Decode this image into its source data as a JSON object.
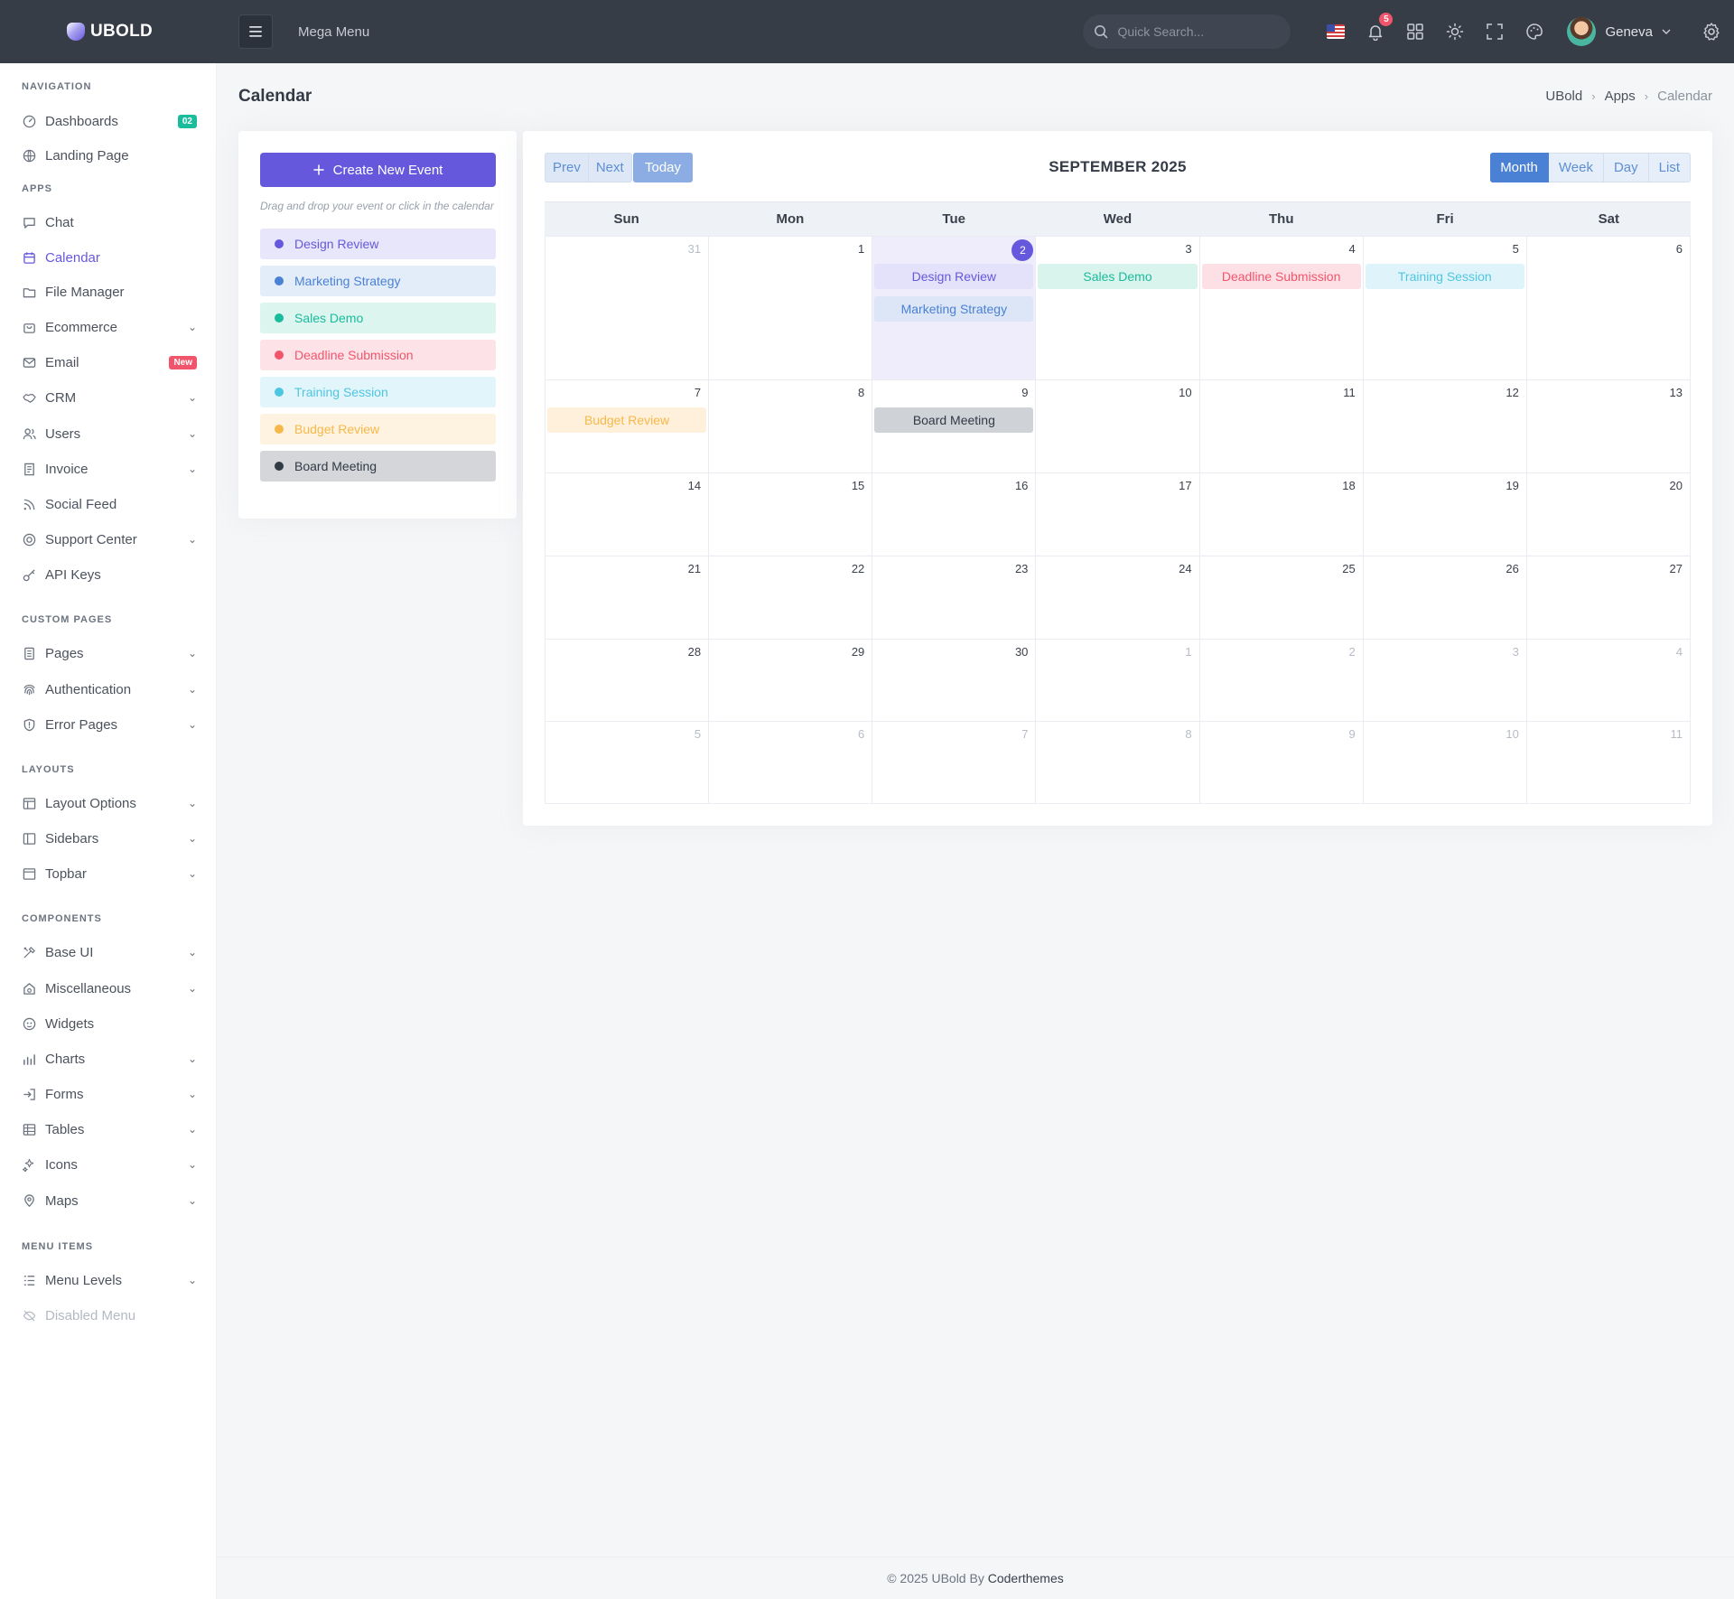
{
  "brand": {
    "name": "UBOLD"
  },
  "topbar": {
    "menu_toggle_icon": "hamburger-icon",
    "mega_menu_label": "Mega Menu",
    "search_placeholder": "Quick Search...",
    "notification_count": "5",
    "user_name": "Geneva"
  },
  "sidebar": {
    "sections": {
      "navigation": "Navigation",
      "apps": "Apps",
      "custom_pages": "Custom Pages",
      "layouts": "Layouts",
      "components": "Components",
      "menu_items": "Menu Items"
    },
    "items": {
      "dashboards": {
        "label": "Dashboards",
        "badge": "02"
      },
      "landing": {
        "label": "Landing Page"
      },
      "chat": {
        "label": "Chat"
      },
      "calendar": {
        "label": "Calendar"
      },
      "file_manager": {
        "label": "File Manager"
      },
      "ecommerce": {
        "label": "Ecommerce"
      },
      "email": {
        "label": "Email",
        "badge": "New"
      },
      "crm": {
        "label": "CRM"
      },
      "users": {
        "label": "Users"
      },
      "invoice": {
        "label": "Invoice"
      },
      "social_feed": {
        "label": "Social Feed"
      },
      "support_center": {
        "label": "Support Center"
      },
      "api_keys": {
        "label": "API Keys"
      },
      "pages": {
        "label": "Pages"
      },
      "authentication": {
        "label": "Authentication"
      },
      "error_pages": {
        "label": "Error Pages"
      },
      "layout_options": {
        "label": "Layout Options"
      },
      "sidebars": {
        "label": "Sidebars"
      },
      "topbar": {
        "label": "Topbar"
      },
      "base_ui": {
        "label": "Base UI"
      },
      "miscellaneous": {
        "label": "Miscellaneous"
      },
      "widgets": {
        "label": "Widgets"
      },
      "charts": {
        "label": "Charts"
      },
      "forms": {
        "label": "Forms"
      },
      "tables": {
        "label": "Tables"
      },
      "icons": {
        "label": "Icons"
      },
      "maps": {
        "label": "Maps"
      },
      "menu_levels": {
        "label": "Menu Levels"
      },
      "disabled_menu": {
        "label": "Disabled Menu"
      }
    }
  },
  "page": {
    "title": "Calendar",
    "breadcrumb": [
      "UBold",
      "Apps",
      "Calendar"
    ]
  },
  "left_panel": {
    "create_button": "Create New Event",
    "create_icon": "plus-icon",
    "hint": "Drag and drop your event or click in the calendar",
    "events": [
      {
        "label": "Design Review",
        "color": "#6658dd",
        "bg": "#e8e6fa"
      },
      {
        "label": "Marketing Strategy",
        "color": "#4a81d4",
        "bg": "#e3ecf9"
      },
      {
        "label": "Sales Demo",
        "color": "#1abc9c",
        "bg": "#dcf5ef"
      },
      {
        "label": "Deadline Submission",
        "color": "#f1556c",
        "bg": "#fde3e7"
      },
      {
        "label": "Training Session",
        "color": "#4fc6e1",
        "bg": "#e2f5fa"
      },
      {
        "label": "Budget Review",
        "color": "#f7b84b",
        "bg": "#fef3e0"
      },
      {
        "label": "Board Meeting",
        "color": "#323a46",
        "bg": "#d4d6da"
      }
    ]
  },
  "calendar": {
    "month_title": "SEPTEMBER 2025",
    "nav": {
      "prev": "Prev",
      "next": "Next",
      "today": "Today"
    },
    "views": {
      "month": "Month",
      "week": "Week",
      "day": "Day",
      "list": "List"
    },
    "active_view": "month",
    "weekdays": [
      "Sun",
      "Mon",
      "Tue",
      "Wed",
      "Thu",
      "Fri",
      "Sat"
    ],
    "weeks": [
      [
        "31",
        "1",
        "2",
        "3",
        "4",
        "5",
        "6"
      ],
      [
        "7",
        "8",
        "9",
        "10",
        "11",
        "12",
        "13"
      ],
      [
        "14",
        "15",
        "16",
        "17",
        "18",
        "19",
        "20"
      ],
      [
        "21",
        "22",
        "23",
        "24",
        "25",
        "26",
        "27"
      ],
      [
        "28",
        "29",
        "30",
        "1",
        "2",
        "3",
        "4"
      ],
      [
        "5",
        "6",
        "7",
        "8",
        "9",
        "10",
        "11"
      ]
    ],
    "today": "2",
    "events": {
      "design_review": "Design Review",
      "marketing_strategy": "Marketing Strategy",
      "sales_demo": "Sales Demo",
      "deadline_submission": "Deadline Submission",
      "training_session": "Training Session",
      "budget_review": "Budget Review",
      "board_meeting": "Board Meeting"
    }
  },
  "footer": {
    "text": "© 2025 UBold By",
    "brand": "Coderthemes"
  }
}
